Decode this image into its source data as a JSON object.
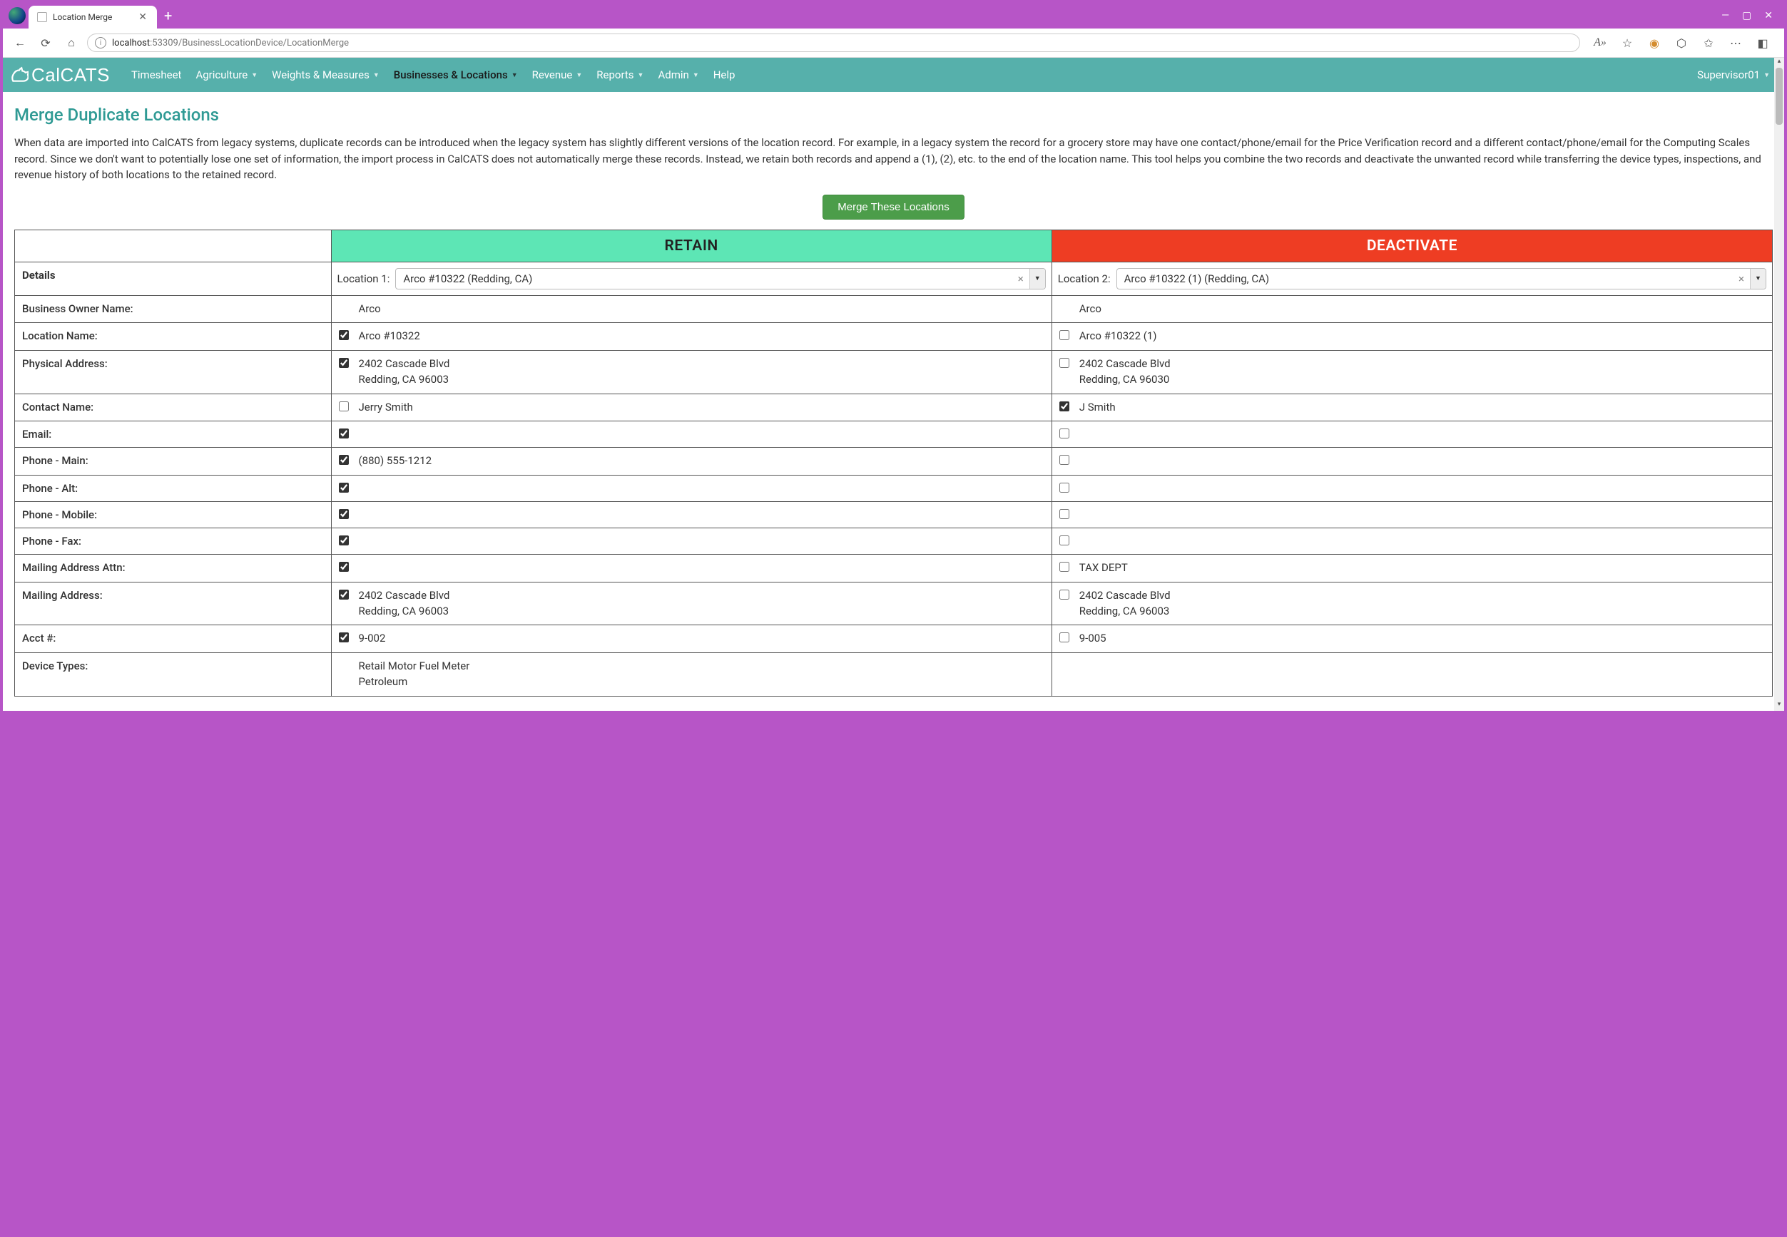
{
  "browser": {
    "tab_title": "Location Merge",
    "url_host": "localhost",
    "url_port": ":53309",
    "url_path": "/BusinessLocationDevice/LocationMerge"
  },
  "nav": {
    "logo": "CalCATS",
    "items": [
      "Timesheet",
      "Agriculture",
      "Weights & Measures",
      "Businesses & Locations",
      "Revenue",
      "Reports",
      "Admin",
      "Help"
    ],
    "dropdown_flags": [
      false,
      true,
      true,
      true,
      true,
      true,
      true,
      false
    ],
    "active_index": 3,
    "user": "Supervisor01"
  },
  "page": {
    "title": "Merge Duplicate Locations",
    "intro": "When data are imported into CalCATS from legacy systems, duplicate records can be introduced when the legacy system has slightly different versions of the location record. For example, in a legacy system the record for a grocery store may have one contact/phone/email for the Price Verification record and a different contact/phone/email for the Computing Scales record. Since we don't want to potentially lose one set of information, the import process in CalCATS does not automatically merge these records. Instead, we retain both records and append a (1), (2), etc. to the end of the location name. This tool helps you combine the two records and deactivate the unwanted record while transferring the device types, inspections, and revenue history of both locations to the retained record.",
    "merge_button": "Merge These Locations",
    "col_retain": "RETAIN",
    "col_deactivate": "DEACTIVATE",
    "details_label": "Details",
    "loc1_label": "Location 1:",
    "loc2_label": "Location 2:",
    "loc1_value": "Arco #10322 (Redding, CA)",
    "loc2_value": "Arco #10322 (1) (Redding, CA)",
    "rows": [
      {
        "label": "Business Owner Name:",
        "l_check": null,
        "l_text": "Arco",
        "r_check": null,
        "r_text": "Arco"
      },
      {
        "label": "Location Name:",
        "l_check": true,
        "l_text": "Arco #10322",
        "r_check": false,
        "r_text": "Arco #10322 (1)"
      },
      {
        "label": "Physical Address:",
        "l_check": true,
        "l_text": "2402 Cascade Blvd\nRedding, CA 96003",
        "r_check": false,
        "r_text": "2402 Cascade Blvd\nRedding, CA 96030"
      },
      {
        "label": "Contact Name:",
        "l_check": false,
        "l_text": "Jerry Smith",
        "r_check": true,
        "r_text": "J Smith"
      },
      {
        "label": "Email:",
        "l_check": true,
        "l_text": "",
        "r_check": false,
        "r_text": ""
      },
      {
        "label": "Phone - Main:",
        "l_check": true,
        "l_text": "(880) 555-1212",
        "r_check": false,
        "r_text": ""
      },
      {
        "label": "Phone - Alt:",
        "l_check": true,
        "l_text": "",
        "r_check": false,
        "r_text": ""
      },
      {
        "label": "Phone - Mobile:",
        "l_check": true,
        "l_text": "",
        "r_check": false,
        "r_text": ""
      },
      {
        "label": "Phone - Fax:",
        "l_check": true,
        "l_text": "",
        "r_check": false,
        "r_text": ""
      },
      {
        "label": "Mailing Address Attn:",
        "l_check": true,
        "l_text": "",
        "r_check": false,
        "r_text": "TAX DEPT"
      },
      {
        "label": "Mailing Address:",
        "l_check": true,
        "l_text": "2402 Cascade Blvd\nRedding, CA 96003",
        "r_check": false,
        "r_text": "2402 Cascade Blvd\nRedding, CA 96003"
      },
      {
        "label": "Acct #:",
        "l_check": true,
        "l_text": "9-002",
        "r_check": false,
        "r_text": "9-005"
      },
      {
        "label": "Device Types:",
        "l_check": null,
        "l_text": "Retail Motor Fuel Meter\nPetroleum",
        "r_check": null,
        "r_text": ""
      }
    ]
  }
}
